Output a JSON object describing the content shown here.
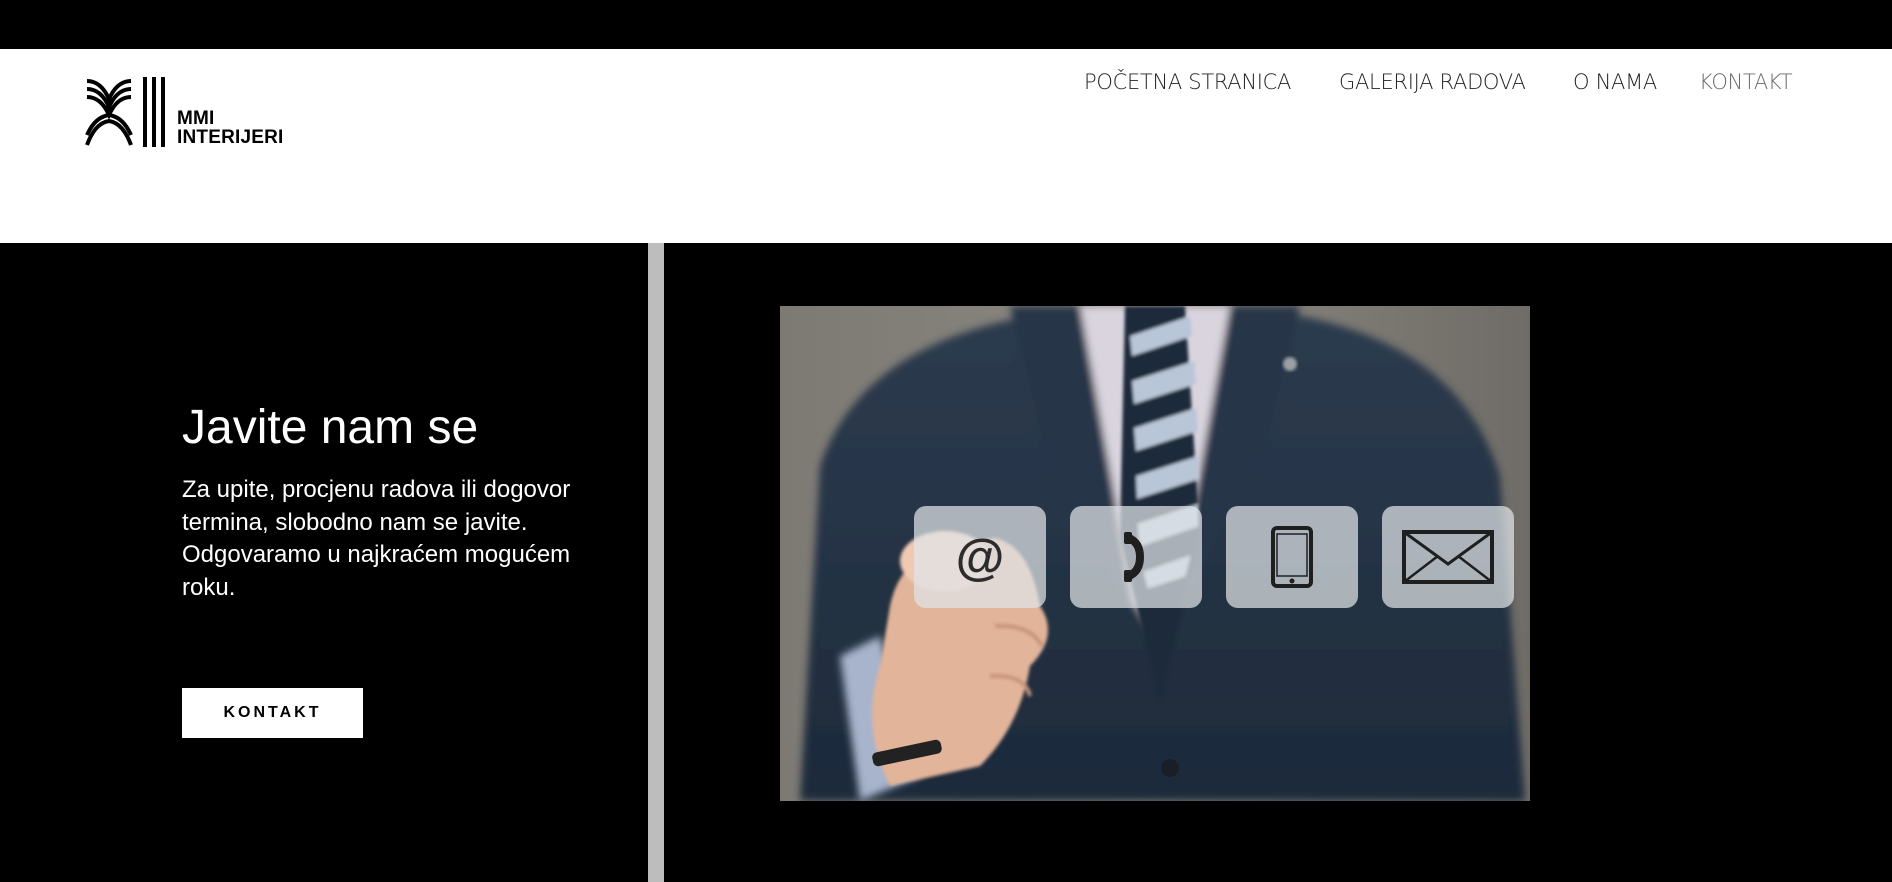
{
  "brand": {
    "line1": "MMI",
    "line2": "INTERIJERI"
  },
  "nav": {
    "items": [
      {
        "label": "POČETNA STRANICA"
      },
      {
        "label": "GALERIJA RADOVA"
      },
      {
        "label": "O NAMA"
      },
      {
        "label": "KONTAKT",
        "active": true
      }
    ]
  },
  "hero": {
    "heading": "Javite nam se",
    "description_line1": "Za upite, procjenu radova ili dogovor termina, slobodno nam se javite.",
    "description_line2": "Odgovaramo u najkraćem mogućem roku.",
    "button_label": "KONTAKT"
  },
  "photo": {
    "icons": [
      "at-sign-icon",
      "phone-icon",
      "mobile-icon",
      "envelope-icon"
    ],
    "at_symbol": "@"
  },
  "colors": {
    "background": "#000000",
    "header": "#ffffff",
    "divider": "#bdbdbd",
    "nav_active": "#6a6a6a"
  }
}
